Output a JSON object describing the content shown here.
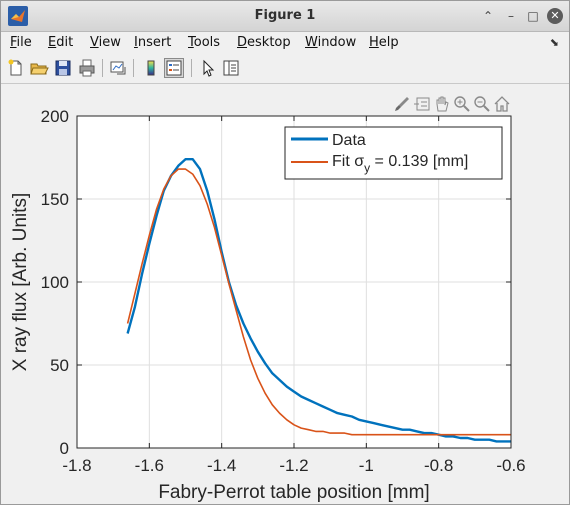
{
  "window": {
    "title": "Figure 1"
  },
  "menu": {
    "items": [
      {
        "label": "File",
        "u": "F",
        "rest": "ile"
      },
      {
        "label": "Edit",
        "u": "E",
        "rest": "dit"
      },
      {
        "label": "View",
        "u": "V",
        "rest": "iew"
      },
      {
        "label": "Insert",
        "u": "I",
        "rest": "nsert"
      },
      {
        "label": "Tools",
        "u": "T",
        "rest": "ools"
      },
      {
        "label": "Desktop",
        "u": "D",
        "rest": "esktop"
      },
      {
        "label": "Window",
        "u": "W",
        "rest": "indow"
      },
      {
        "label": "Help",
        "u": "H",
        "rest": "elp"
      }
    ]
  },
  "toolbar": {
    "icons": [
      "new-figure-icon",
      "open-file-icon",
      "save-icon",
      "print-icon",
      "link-plot-icon",
      "colorbar-icon",
      "legend-icon",
      "pointer-icon",
      "property-inspector-icon"
    ]
  },
  "axes_toolbar": {
    "icons": [
      "brush-icon",
      "data-tips-icon",
      "pan-icon",
      "zoom-in-icon",
      "zoom-out-icon",
      "home-icon"
    ]
  },
  "colors": {
    "data": "#0072bd",
    "fit": "#d95319",
    "axes_bg": "#ffffff",
    "grid": "#dfdfdf",
    "figure_bg": "#f0f0f0"
  },
  "chart_data": {
    "type": "line",
    "xlabel": "Fabry-Perrot table position [mm]",
    "ylabel": "X ray flux [Arb. Units]",
    "xlim": [
      -1.8,
      -0.6
    ],
    "ylim": [
      0,
      200
    ],
    "xticks": [
      -1.8,
      -1.6,
      -1.4,
      -1.2,
      -1,
      -0.8,
      -0.6
    ],
    "xtick_labels": [
      "-1.8",
      "-1.6",
      "-1.4",
      "-1.2",
      "-1",
      "-0.8",
      "-0.6"
    ],
    "yticks": [
      0,
      50,
      100,
      150,
      200
    ],
    "ytick_labels": [
      "0",
      "50",
      "100",
      "150",
      "200"
    ],
    "grid": true,
    "legend_position": "top-right",
    "legend_entries": [
      "Data",
      "Fit σ",
      "y",
      " = 0.139 [mm]"
    ],
    "series": [
      {
        "name": "Data",
        "x": [
          -1.66,
          -1.64,
          -1.62,
          -1.6,
          -1.58,
          -1.56,
          -1.54,
          -1.52,
          -1.5,
          -1.48,
          -1.46,
          -1.44,
          -1.42,
          -1.4,
          -1.38,
          -1.36,
          -1.34,
          -1.32,
          -1.3,
          -1.28,
          -1.26,
          -1.24,
          -1.22,
          -1.2,
          -1.18,
          -1.16,
          -1.14,
          -1.12,
          -1.1,
          -1.08,
          -1.06,
          -1.04,
          -1.02,
          -1.0,
          -0.98,
          -0.96,
          -0.94,
          -0.92,
          -0.9,
          -0.88,
          -0.86,
          -0.84,
          -0.82,
          -0.8,
          -0.78,
          -0.76,
          -0.74,
          -0.72,
          -0.7,
          -0.68,
          -0.66,
          -0.64,
          -0.62,
          -0.6
        ],
        "y": [
          69,
          85,
          105,
          123,
          140,
          155,
          164,
          170,
          174,
          174,
          168,
          155,
          138,
          118,
          100,
          86,
          75,
          66,
          58,
          51,
          45,
          41,
          37,
          34,
          31,
          29,
          27,
          25,
          23,
          21,
          20,
          19,
          17,
          16,
          15,
          14,
          13,
          12,
          11,
          11,
          10,
          9,
          9,
          8,
          7,
          7,
          6,
          6,
          5,
          5,
          5,
          4,
          4,
          4
        ]
      },
      {
        "name": "Fit",
        "x": [
          -1.66,
          -1.64,
          -1.62,
          -1.6,
          -1.58,
          -1.56,
          -1.54,
          -1.52,
          -1.5,
          -1.48,
          -1.46,
          -1.44,
          -1.42,
          -1.4,
          -1.38,
          -1.36,
          -1.34,
          -1.32,
          -1.3,
          -1.28,
          -1.26,
          -1.24,
          -1.22,
          -1.2,
          -1.18,
          -1.16,
          -1.14,
          -1.12,
          -1.1,
          -1.08,
          -1.06,
          -1.04,
          -1.02,
          -1.0,
          -0.98,
          -0.96,
          -0.94,
          -0.92,
          -0.9,
          -0.88,
          -0.86,
          -0.84,
          -0.82,
          -0.8,
          -0.78,
          -0.76,
          -0.74,
          -0.72,
          -0.7,
          -0.68,
          -0.66,
          -0.64,
          -0.62,
          -0.6
        ],
        "y": [
          75,
          93,
          111,
          128,
          144,
          156,
          164,
          168,
          168,
          165,
          158,
          147,
          133,
          116,
          99,
          83,
          67,
          53,
          42,
          33,
          26,
          21,
          17,
          14,
          12,
          11,
          10,
          10,
          9,
          9,
          9,
          8,
          8,
          8,
          8,
          8,
          8,
          8,
          8,
          8,
          8,
          8,
          8,
          8,
          8,
          8,
          8,
          8,
          8,
          8,
          8,
          8,
          8,
          8
        ]
      }
    ]
  }
}
